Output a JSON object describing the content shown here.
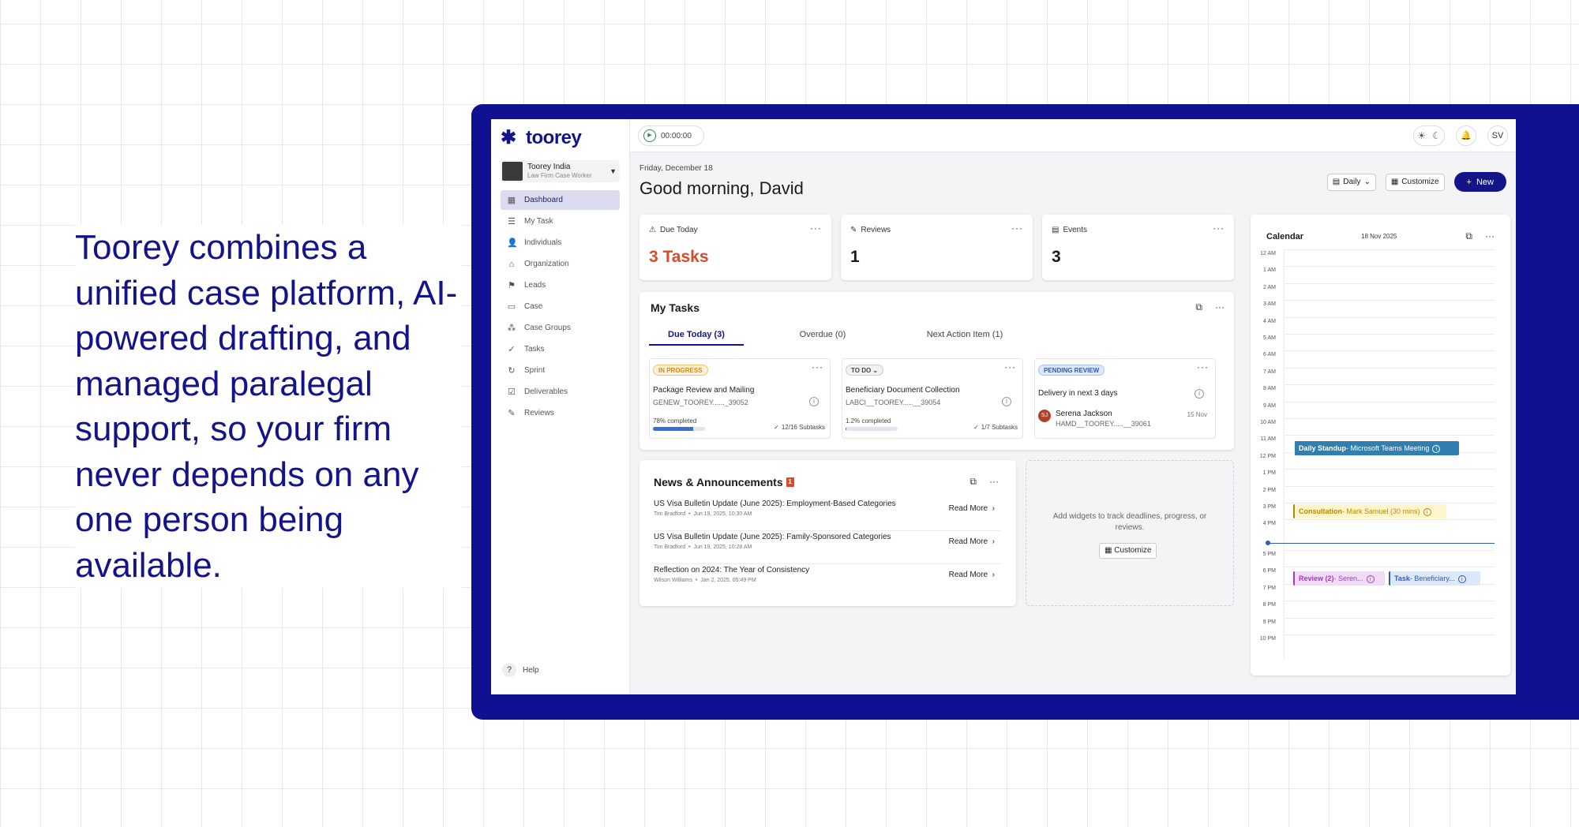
{
  "headline": "Toorey combines a unified case platform, AI-powered drafting, and managed paralegal support, so your firm never depends on any one person being available.",
  "brand": {
    "name": "toorey",
    "color": "#13148a"
  },
  "org": {
    "name": "Toorey India",
    "role": "Law Firm Case Worker"
  },
  "sidebar": {
    "items": [
      {
        "label": "Dashboard",
        "icon": "grid-icon",
        "active": true
      },
      {
        "label": "My Task",
        "icon": "list-icon"
      },
      {
        "label": "Individuals",
        "icon": "person-icon"
      },
      {
        "label": "Organization",
        "icon": "building-icon"
      },
      {
        "label": "Leads",
        "icon": "leads-icon"
      },
      {
        "label": "Case",
        "icon": "briefcase-icon"
      },
      {
        "label": "Case Groups",
        "icon": "groups-icon"
      },
      {
        "label": "Tasks",
        "icon": "check-circle-icon"
      },
      {
        "label": "Sprint",
        "icon": "sprint-icon"
      },
      {
        "label": "Deliverables",
        "icon": "checkbox-icon"
      },
      {
        "label": "Reviews",
        "icon": "review-icon"
      }
    ],
    "help": "Help"
  },
  "topbar": {
    "timer": "00:00:00",
    "user_initials": "SV"
  },
  "header": {
    "date": "Friday, December 18",
    "greeting": "Good morning, David",
    "view": "Daily",
    "customize": "Customize",
    "new": "New"
  },
  "stats": [
    {
      "title": "Due Today",
      "value": "3 Tasks",
      "icon": "warning-icon",
      "highlight": true
    },
    {
      "title": "Reviews",
      "value": "1",
      "icon": "review-icon"
    },
    {
      "title": "Events",
      "value": "3",
      "icon": "calendar-icon"
    }
  ],
  "my_tasks": {
    "title": "My Tasks",
    "tabs": [
      "Due Today (3)",
      "Overdue (0)",
      "Next Action Item (1)"
    ],
    "cards": [
      {
        "status": "IN PROGRESS",
        "title": "Package Review and Mailing",
        "code": "GENEW_TOOREY......_39052",
        "progress_label": "78% completed",
        "progress": 0.78,
        "subtasks": "12/16 Subtasks"
      },
      {
        "status": "TO DO",
        "title": "Beneficiary Document Collection",
        "code": "LABCI__TOOREY.....__39054",
        "progress_label": "1.2% completed",
        "progress": 0.012,
        "subtasks": "1/7 Subtasks"
      },
      {
        "status": "PENDING REVIEW",
        "title": "Delivery in next 3 days",
        "person_initials": "SJ",
        "person": "Serena Jackson",
        "code": "HAMD__TOOREY.....__39061",
        "date": "15 Nov"
      }
    ]
  },
  "news": {
    "title": "News & Announcements",
    "count": "1",
    "read_more": "Read More",
    "items": [
      {
        "title": "US Visa Bulletin Update (June 2025): Employment-Based Categories",
        "author": "Tim Bradford",
        "date": "Jun 19, 2025, 10:30 AM"
      },
      {
        "title": "US Visa Bulletin Update (June 2025): Family-Sponsored Categories",
        "author": "Tim Bradford",
        "date": "Jun 19, 2025, 10:28 AM"
      },
      {
        "title": "Reflection on 2024: The Year of Consistency",
        "author": "Wilson Williams",
        "date": "Jan 2, 2025, 05:49 PM"
      }
    ]
  },
  "widget": {
    "text": "Add widgets to track deadlines, progress, or reviews.",
    "button": "Customize"
  },
  "calendar": {
    "title": "Calendar",
    "date": "18 Nov 2025",
    "hours": [
      "12 AM",
      "1 AM",
      "2 AM",
      "3 AM",
      "4 AM",
      "5 AM",
      "6 AM",
      "7 AM",
      "8 AM",
      "9 AM",
      "10 AM",
      "11 AM",
      "12 PM",
      "1 PM",
      "2 PM",
      "3 PM",
      "4 PM",
      "5 PM",
      "6 PM",
      "7 PM",
      "8 PM",
      "9 PM",
      "10 PM"
    ],
    "events": [
      {
        "title": "Daily Standup",
        "detail": "- Microsoft Teams Meeting",
        "bg": "#2f7fb0",
        "fg": "#ffffff"
      },
      {
        "title": "Consultation",
        "detail": "- Mark Samuel (30 mins)",
        "bg": "#fff6cc",
        "fg": "#b8860b"
      },
      {
        "title": "Review (2)",
        "detail": "- Seren...",
        "bg": "#f1dcf8",
        "fg": "#a23ac0"
      },
      {
        "title": "Task",
        "detail": "- Beneficiary...",
        "bg": "#dde8fa",
        "fg": "#2c5bb8"
      }
    ]
  }
}
